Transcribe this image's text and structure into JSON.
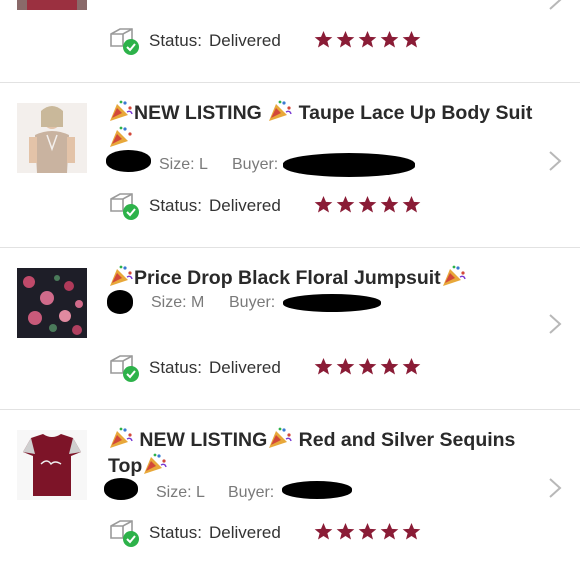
{
  "colors": {
    "star": "#8a1c36",
    "check": "#2db24a",
    "divider": "#e2e2e2",
    "chevron": "#b8b8b8"
  },
  "icons": {
    "status": "package-delivered-icon",
    "rating": "star-icon",
    "nav": "chevron-right-icon",
    "emoji": "party-popper-icon"
  },
  "rating_max": 5,
  "rows": [
    {
      "status_label": "Status:",
      "status_value": "Delivered",
      "rating": 5
    },
    {
      "title": "NEW LISTING",
      "title_rest": "Taupe Lace Up Body Suit",
      "size": "Size: L",
      "buyer": "Buyer:",
      "status_label": "Status:",
      "status_value": "Delivered",
      "rating": 5
    },
    {
      "title": "Price Drop Black Floral Jumpsuit",
      "size": "Size: M",
      "buyer": "Buyer:",
      "status_label": "Status:",
      "status_value": "Delivered",
      "rating": 5
    },
    {
      "title": "NEW LISTING",
      "title_rest": "Red and Silver Sequins",
      "title_line2": "Top",
      "size": "Size: L",
      "buyer": "Buyer:",
      "status_label": "Status:",
      "status_value": "Delivered",
      "rating": 5
    }
  ]
}
